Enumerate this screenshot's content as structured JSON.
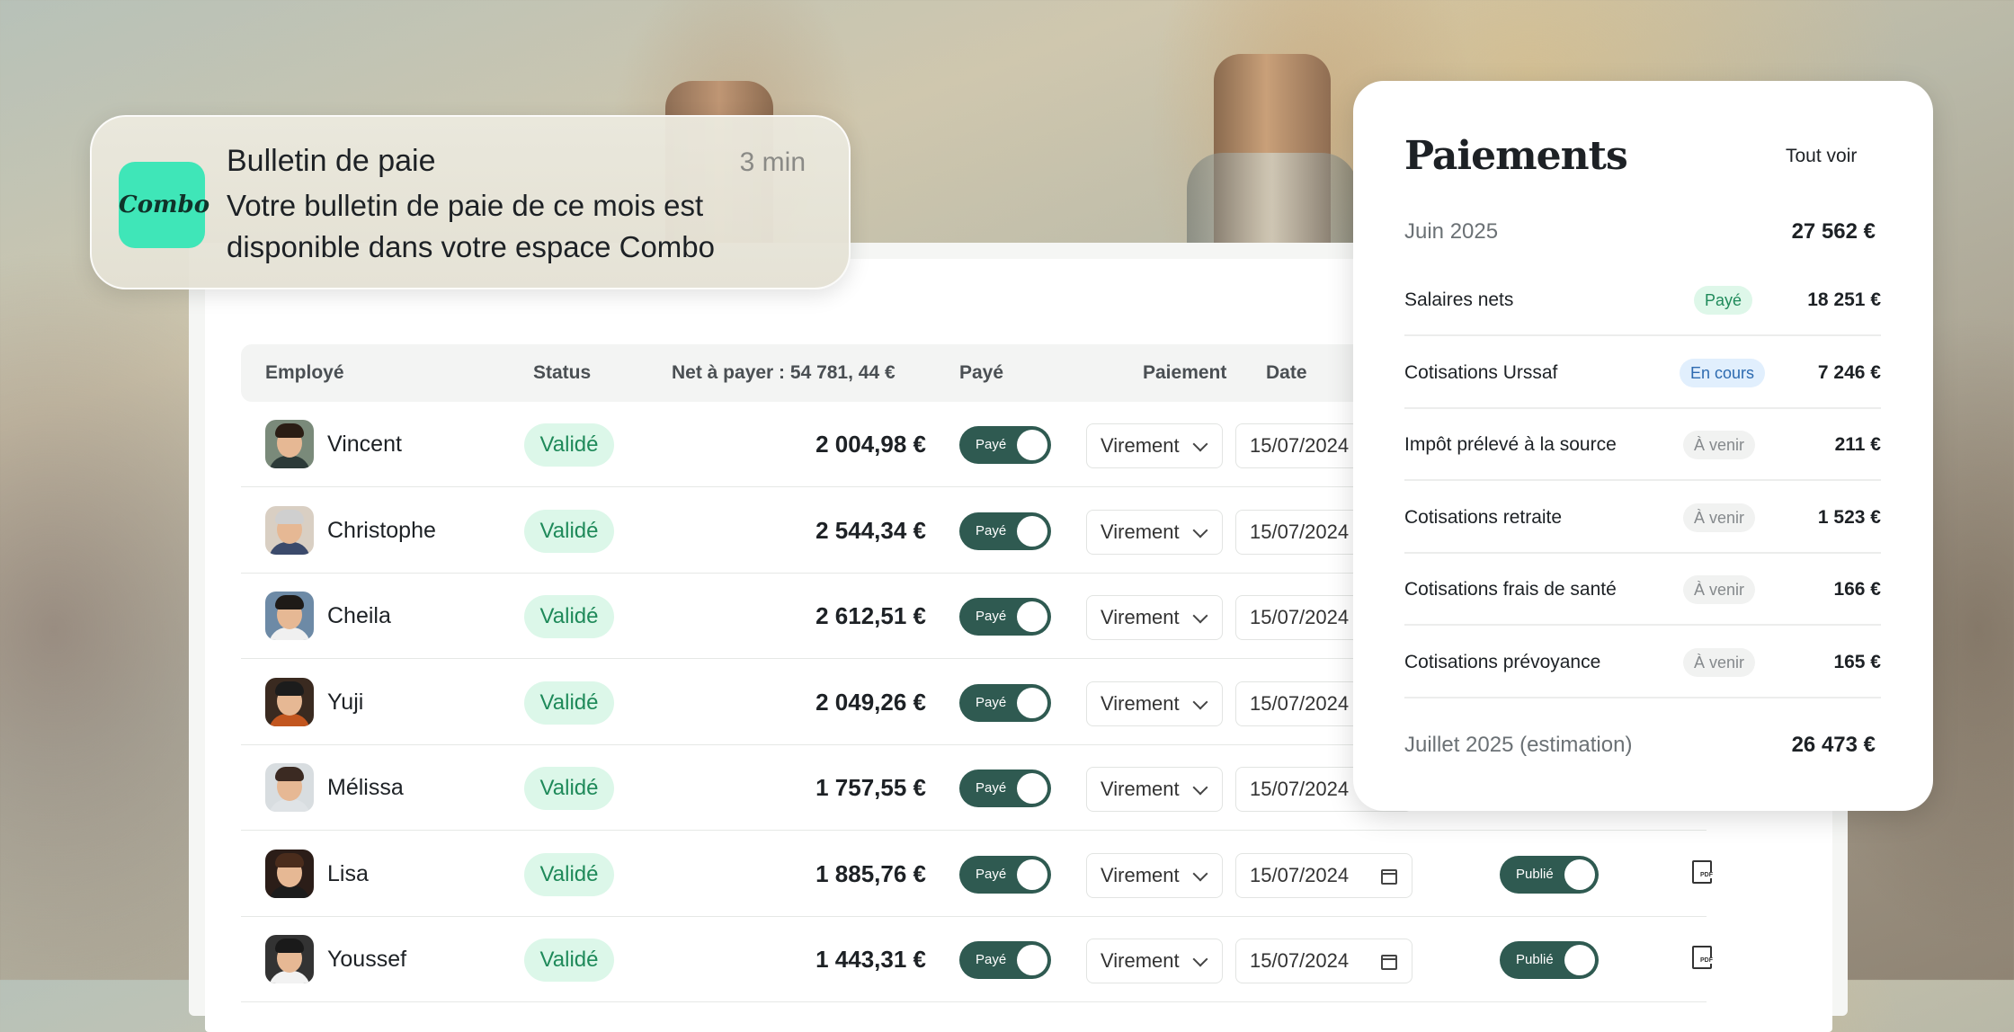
{
  "notification": {
    "logo_text": "Combo",
    "title": "Bulletin de paie",
    "time": "3 min",
    "body": "Votre bulletin de paie de ce mois est disponible dans votre espace Combo"
  },
  "table": {
    "headers": {
      "employee": "Employé",
      "status": "Status",
      "net": "Net à payer : 54 781, 44 €",
      "paid": "Payé",
      "payment": "Paiement",
      "date": "Date"
    },
    "rows": [
      {
        "name": "Vincent",
        "status": "Validé",
        "amount": "2 004,98 €",
        "paid_label": "Payé",
        "payment": "Virement",
        "date": "15/07/2024"
      },
      {
        "name": "Christophe",
        "status": "Validé",
        "amount": "2 544,34 €",
        "paid_label": "Payé",
        "payment": "Virement",
        "date": "15/07/2024"
      },
      {
        "name": "Cheila",
        "status": "Validé",
        "amount": "2 612,51 €",
        "paid_label": "Payé",
        "payment": "Virement",
        "date": "15/07/2024"
      },
      {
        "name": "Yuji",
        "status": "Validé",
        "amount": "2 049,26 €",
        "paid_label": "Payé",
        "payment": "Virement",
        "date": "15/07/2024"
      },
      {
        "name": "Mélissa",
        "status": "Validé",
        "amount": "1 757,55 €",
        "paid_label": "Payé",
        "payment": "Virement",
        "date": "15/07/2024"
      },
      {
        "name": "Lisa",
        "status": "Validé",
        "amount": "1 885,76 €",
        "paid_label": "Payé",
        "payment": "Virement",
        "date": "15/07/2024",
        "published_label": "Publié"
      },
      {
        "name": "Youssef",
        "status": "Validé",
        "amount": "1 443,31 €",
        "paid_label": "Payé",
        "payment": "Virement",
        "date": "15/07/2024",
        "published_label": "Publié"
      }
    ]
  },
  "payments": {
    "title": "Paiements",
    "see_all": "Tout voir",
    "current": {
      "label": "Juin 2025",
      "total": "27 562 €"
    },
    "items": [
      {
        "label": "Salaires nets",
        "badge": "Payé",
        "badge_type": "paid",
        "amount": "18 251 €"
      },
      {
        "label": "Cotisations Urssaf",
        "badge": "En cours",
        "badge_type": "in-progress",
        "amount": "7 246 €"
      },
      {
        "label": "Impôt prélevé à la source",
        "badge": "À venir",
        "badge_type": "upcoming",
        "amount": "211 €"
      },
      {
        "label": "Cotisations retraite",
        "badge": "À venir",
        "badge_type": "upcoming",
        "amount": "1 523 €"
      },
      {
        "label": "Cotisations frais de santé",
        "badge": "À venir",
        "badge_type": "upcoming",
        "amount": "166 €"
      },
      {
        "label": "Cotisations prévoyance",
        "badge": "À venir",
        "badge_type": "upcoming",
        "amount": "165 €"
      }
    ],
    "next": {
      "label": "Juillet 2025 (estimation)",
      "total": "26 473 €"
    }
  },
  "colors": {
    "accent_dark_green": "#2f5a51",
    "status_green_bg": "#dcf7e9",
    "status_green_text": "#1f8a5a",
    "logo_mint": "#3fe6b8"
  }
}
